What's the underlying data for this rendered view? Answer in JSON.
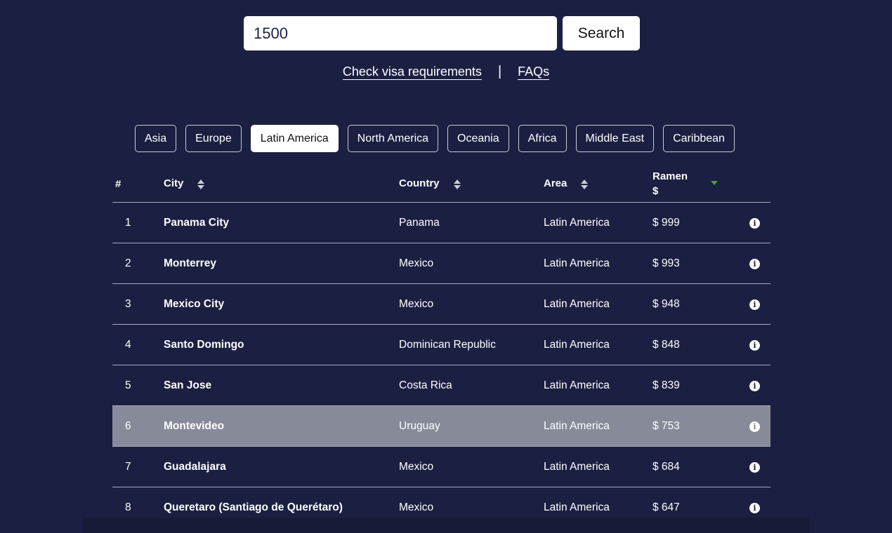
{
  "search": {
    "value": "1500",
    "button_label": "Search"
  },
  "links": {
    "visa": "Check visa requirements",
    "separator": "|",
    "faqs": "FAQs"
  },
  "filters": [
    {
      "label": "Asia",
      "active": false
    },
    {
      "label": "Europe",
      "active": false
    },
    {
      "label": "Latin America",
      "active": true
    },
    {
      "label": "North America",
      "active": false
    },
    {
      "label": "Oceania",
      "active": false
    },
    {
      "label": "Africa",
      "active": false
    },
    {
      "label": "Middle East",
      "active": false
    },
    {
      "label": "Caribbean",
      "active": false
    }
  ],
  "table": {
    "headers": {
      "num": "#",
      "city": "City",
      "country": "Country",
      "area": "Area",
      "ramen_line1": "Ramen",
      "ramen_line2": "$"
    },
    "sort": {
      "column": "ramen",
      "direction": "descending",
      "color": "#3ea043"
    },
    "highlight_color": "#878a99",
    "rows": [
      {
        "num": "1",
        "city": "Panama City",
        "country": "Panama",
        "area": "Latin America",
        "price": "$ 999"
      },
      {
        "num": "2",
        "city": "Monterrey",
        "country": "Mexico",
        "area": "Latin America",
        "price": "$ 993"
      },
      {
        "num": "3",
        "city": "Mexico City",
        "country": "Mexico",
        "area": "Latin America",
        "price": "$ 948"
      },
      {
        "num": "4",
        "city": "Santo Domingo",
        "country": "Dominican Republic",
        "area": "Latin America",
        "price": "$ 848"
      },
      {
        "num": "5",
        "city": "San Jose",
        "country": "Costa Rica",
        "area": "Latin America",
        "price": "$ 839"
      },
      {
        "num": "6",
        "city": "Montevideo",
        "country": "Uruguay",
        "area": "Latin America",
        "price": "$ 753",
        "highlighted": true
      },
      {
        "num": "7",
        "city": "Guadalajara",
        "country": "Mexico",
        "area": "Latin America",
        "price": "$ 684"
      },
      {
        "num": "8",
        "city": "Queretaro (Santiago de Querétaro)",
        "country": "Mexico",
        "area": "Latin America",
        "price": "$ 647"
      }
    ]
  },
  "colors": {
    "background": "#1b2042",
    "row_highlight": "#878a99"
  }
}
